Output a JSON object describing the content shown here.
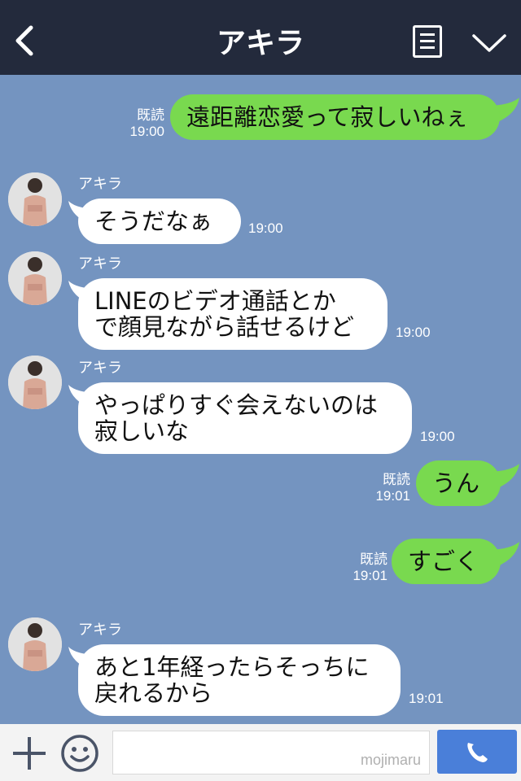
{
  "header": {
    "title": "アキラ",
    "back_icon": "chevron-left-icon",
    "menu_icon": "list-menu-icon",
    "toggle_icon": "chevron-down-icon"
  },
  "colors": {
    "header_bg": "#232a3c",
    "chat_bg": "#7494c0",
    "my_bubble": "#79d94f",
    "their_bubble": "#ffffff",
    "send_button": "#4a7fd9"
  },
  "messages": [
    {
      "from": "me",
      "read": "既読",
      "time": "19:00",
      "lines": [
        "遠距離恋愛って寂しいねぇ"
      ]
    },
    {
      "from": "them",
      "sender": "アキラ",
      "time": "19:00",
      "lines": [
        "そうだなぁ"
      ]
    },
    {
      "from": "them",
      "sender": "アキラ",
      "time": "19:00",
      "lines": [
        "LINEのビデオ通話とか",
        "で顔見ながら話せるけど"
      ]
    },
    {
      "from": "them",
      "sender": "アキラ",
      "time": "19:00",
      "lines": [
        "やっぱりすぐ会えないのは",
        "寂しいな"
      ]
    },
    {
      "from": "me",
      "read": "既読",
      "time": "19:01",
      "lines": [
        "うん"
      ]
    },
    {
      "from": "me",
      "read": "既読",
      "time": "19:01",
      "lines": [
        "すごく"
      ]
    },
    {
      "from": "them",
      "sender": "アキラ",
      "time": "19:01",
      "lines": [
        "あと1年経ったらそっちに",
        "戻れるから"
      ]
    }
  ],
  "input_bar": {
    "plus_icon": "plus-icon",
    "emoji_icon": "smiley-icon",
    "input_value": "",
    "watermark": "mojimaru",
    "call_icon": "phone-icon"
  }
}
